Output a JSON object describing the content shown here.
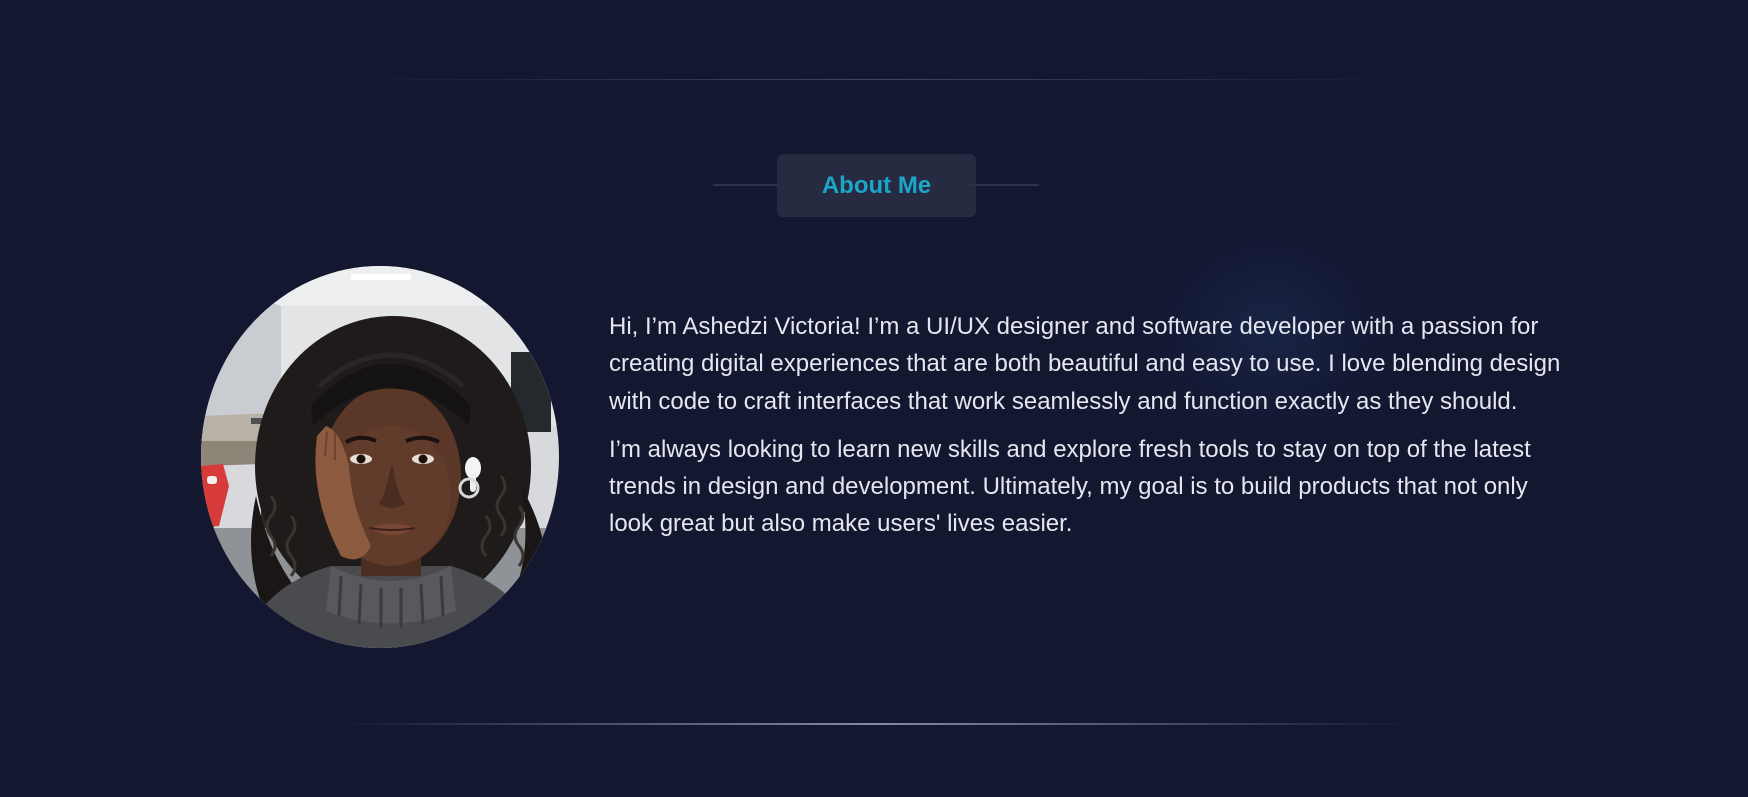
{
  "about": {
    "heading": "About Me",
    "avatar_alt": "Portrait photo of Ashedzi Victoria",
    "paragraphs": [
      "Hi, I’m Ashedzi Victoria! I’m a UI/UX designer and software developer with a passion for creating digital experiences that are both beautiful and easy to use. I love blending design with code to craft interfaces that work seamlessly and function exactly as they should.",
      "I’m always looking to learn new skills and explore fresh tools to stay on top of the latest trends in design and development. Ultimately, my goal is to build products that not only look great but also make users' lives easier."
    ]
  },
  "colors": {
    "background": "#131730",
    "accent": "#1ba6c8",
    "pill": "#262b42",
    "text": "#e4e7f0"
  }
}
